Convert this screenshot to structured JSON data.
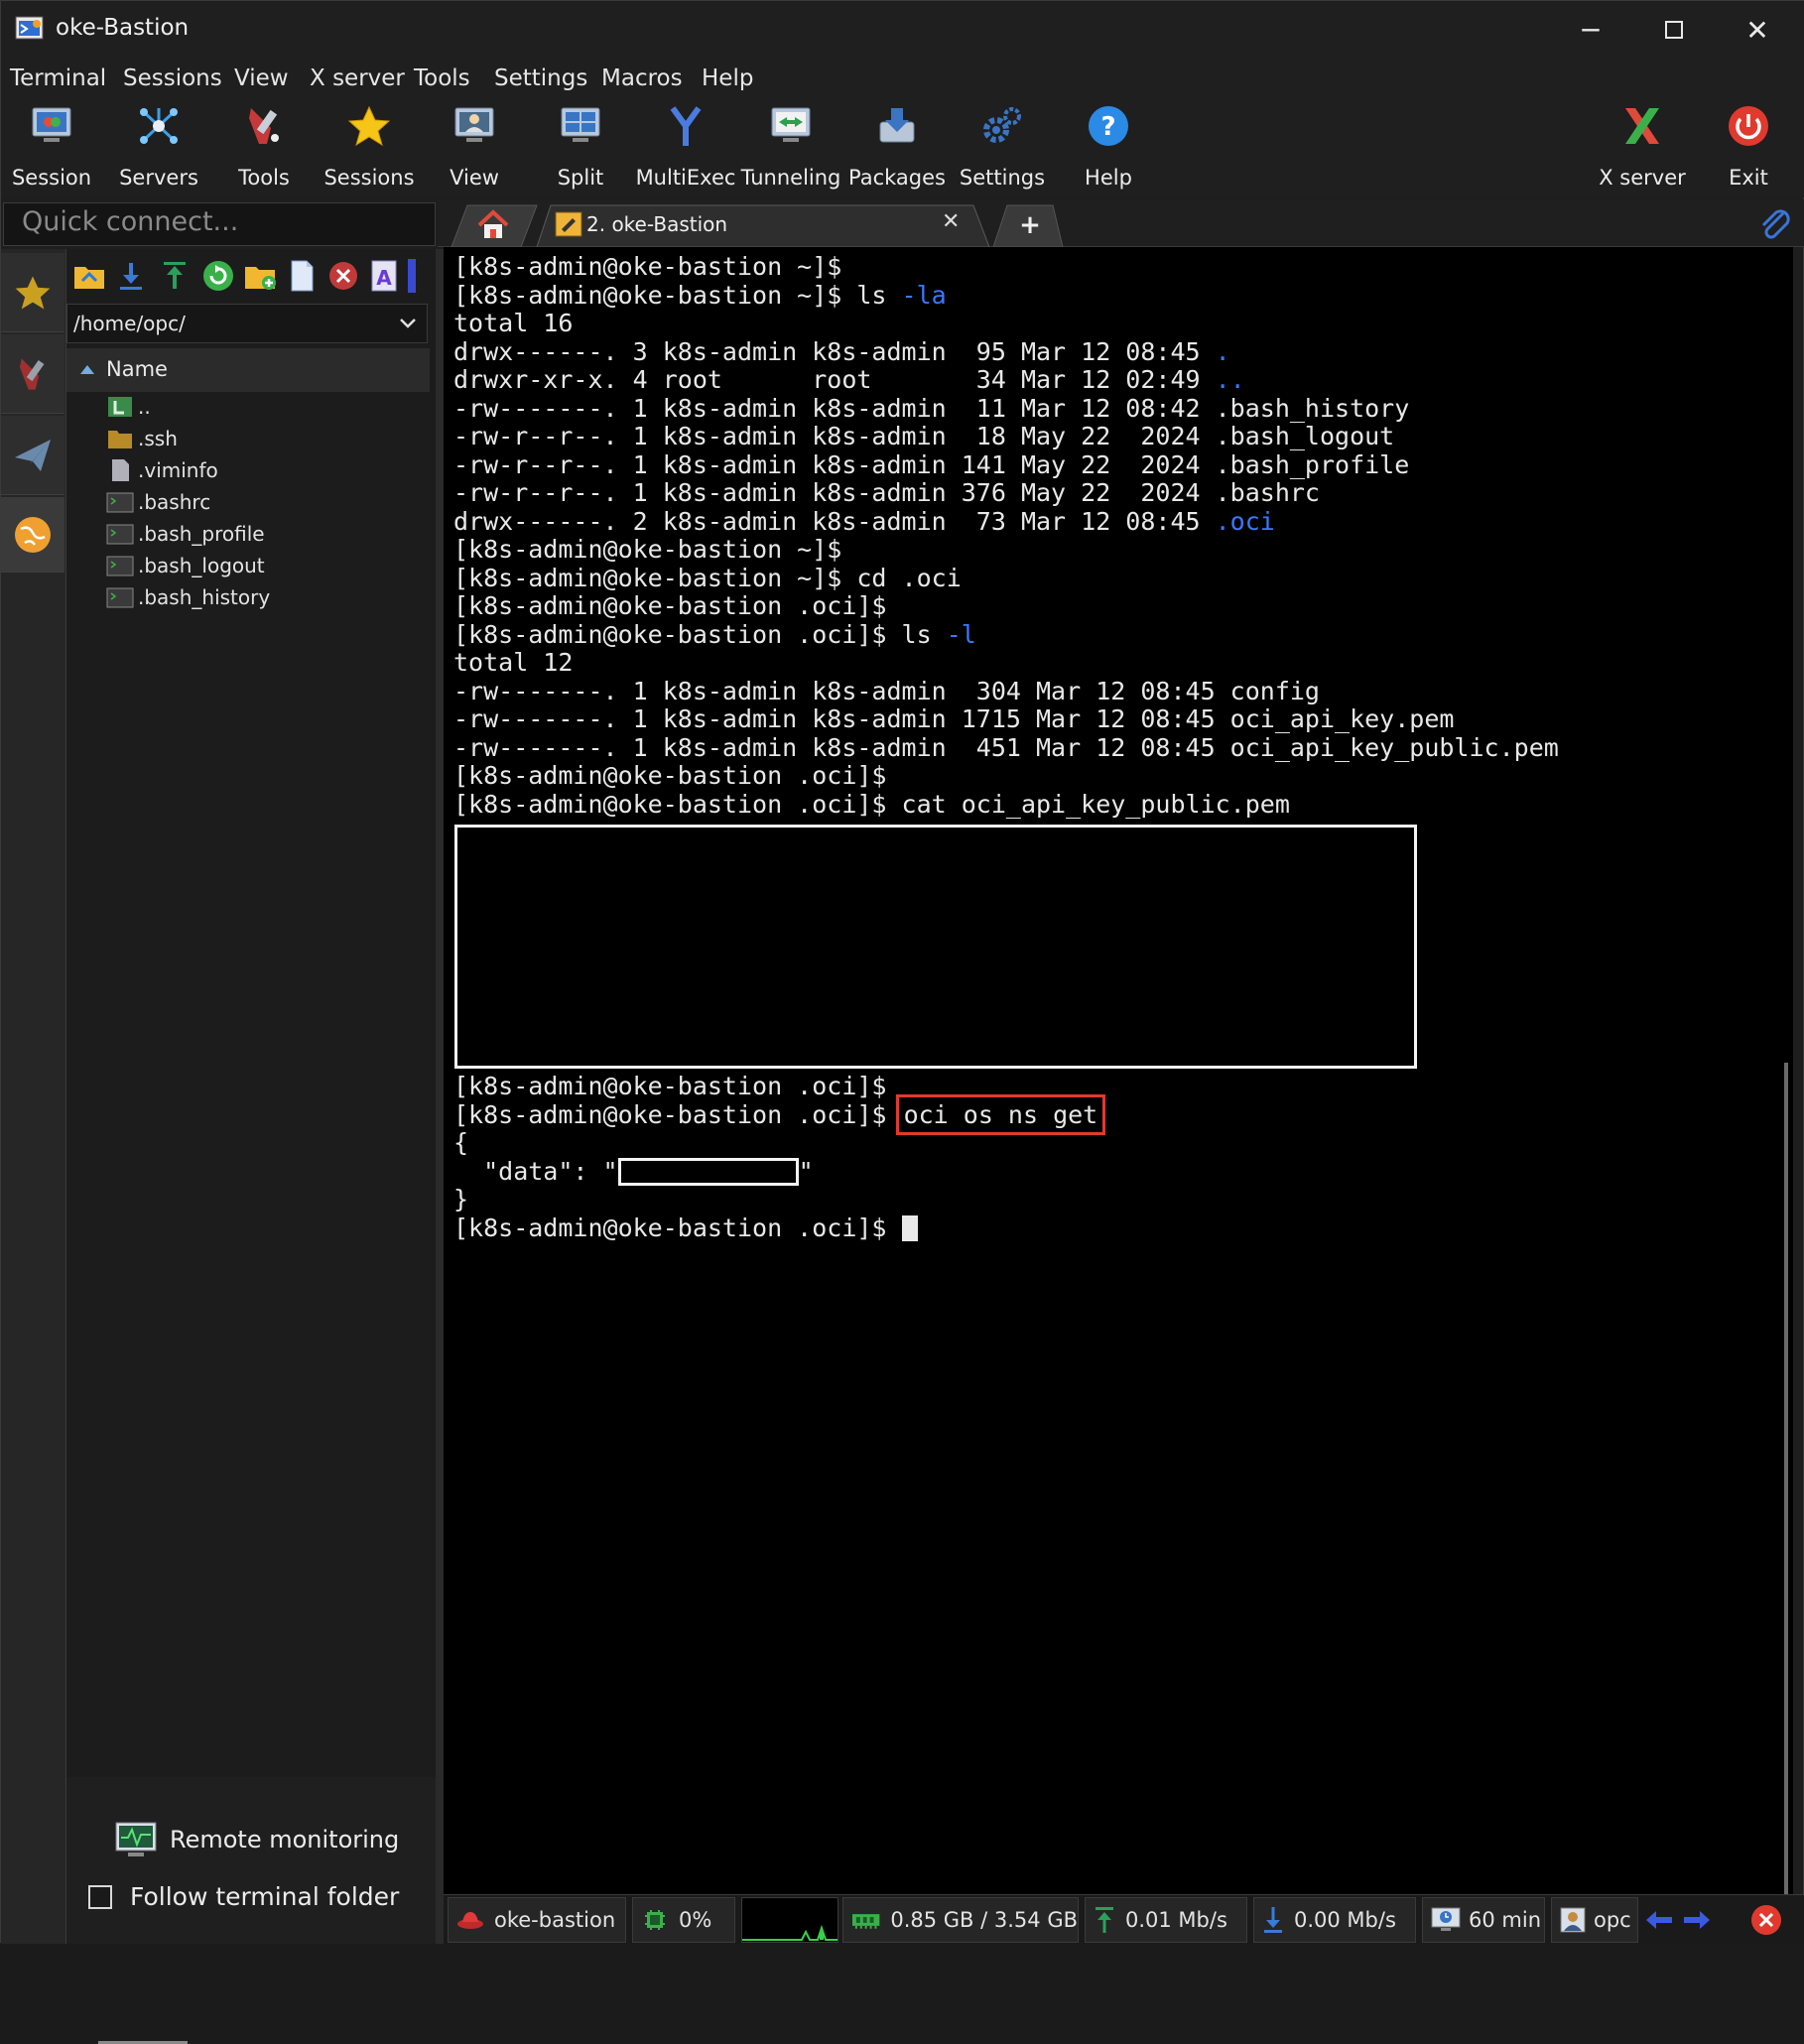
{
  "window": {
    "title": "oke-Bastion"
  },
  "menu": [
    "Terminal",
    "Sessions",
    "View",
    "X server",
    "Tools",
    "Settings",
    "Macros",
    "Help"
  ],
  "toolbar": {
    "session": "Session",
    "servers": "Servers",
    "tools": "Tools",
    "sessions": "Sessions",
    "view": "View",
    "split": "Split",
    "multiexec": "MultiExec",
    "tunneling": "Tunneling",
    "packages": "Packages",
    "settings": "Settings",
    "help": "Help",
    "xserver": "X server",
    "exit": "Exit"
  },
  "quick_connect": {
    "placeholder": "Quick connect..."
  },
  "tabs": {
    "active": "2. oke-Bastion"
  },
  "sftp": {
    "path": "/home/opc/",
    "column": "Name",
    "files": [
      "..",
      ".ssh",
      ".viminfo",
      ".bashrc",
      ".bash_profile",
      ".bash_logout",
      ".bash_history"
    ],
    "remote_monitoring": "Remote monitoring",
    "follow_folder": "Follow terminal folder"
  },
  "terminal": {
    "lines": [
      "[k8s-admin@oke-bastion ~]$",
      "[k8s-admin@oke-bastion ~]$ ls -la",
      "total 16",
      "drwx------. 3 k8s-admin k8s-admin  95 Mar 12 08:45 .",
      "drwxr-xr-x. 4 root      root       34 Mar 12 02:49 ..",
      "-rw-------. 1 k8s-admin k8s-admin  11 Mar 12 08:42 .bash_history",
      "-rw-r--r--. 1 k8s-admin k8s-admin  18 May 22  2024 .bash_logout",
      "-rw-r--r--. 1 k8s-admin k8s-admin 141 May 22  2024 .bash_profile",
      "-rw-r--r--. 1 k8s-admin k8s-admin 376 May 22  2024 .bashrc",
      "drwx------. 2 k8s-admin k8s-admin  73 Mar 12 08:45 .oci",
      "[k8s-admin@oke-bastion ~]$",
      "[k8s-admin@oke-bastion ~]$ cd .oci",
      "[k8s-admin@oke-bastion .oci]$",
      "[k8s-admin@oke-bastion .oci]$ ls -l",
      "total 12",
      "-rw-------. 1 k8s-admin k8s-admin  304 Mar 12 08:45 config",
      "-rw-------. 1 k8s-admin k8s-admin 1715 Mar 12 08:45 oci_api_key.pem",
      "-rw-------. 1 k8s-admin k8s-admin  451 Mar 12 08:45 oci_api_key_public.pem",
      "[k8s-admin@oke-bastion .oci]$",
      "[k8s-admin@oke-bastion .oci]$ cat oci_api_key_public.pem"
    ],
    "after_lines": [
      "[k8s-admin@oke-bastion .oci]$"
    ],
    "prompt": "[k8s-admin@oke-bastion .oci]$",
    "command": "oci os ns get",
    "json_open": "{",
    "json_key": "  \"data\": \"",
    "json_close_quote": "\"",
    "json_close": "}",
    "final_prompt": "[k8s-admin@oke-bastion .oci]$"
  },
  "status": {
    "host": "oke-bastion",
    "cpu": "0%",
    "mem": "0.85 GB / 3.54 GB",
    "up": "0.01 Mb/s",
    "down": "0.00 Mb/s",
    "time": "60 min",
    "user": "opc"
  },
  "colors": {
    "dir_blue": "#3b78ff",
    "highlight_red": "#e03a2f",
    "accent": "#2b8ae6"
  }
}
